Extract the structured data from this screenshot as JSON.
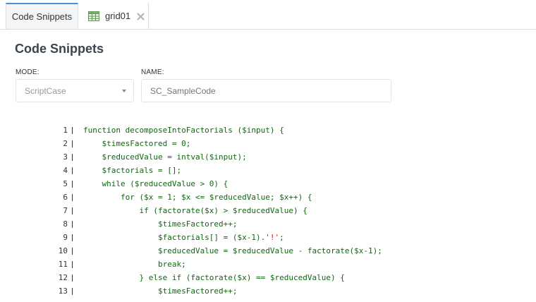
{
  "tabs": [
    {
      "label": "Code Snippets",
      "active": true
    },
    {
      "label": "grid01",
      "icon": "grid-icon",
      "closable": true
    }
  ],
  "page": {
    "title": "Code Snippets"
  },
  "form": {
    "mode": {
      "label": "MODE:",
      "value": "ScriptCase"
    },
    "name": {
      "label": "NAME:",
      "placeholder": "SC_SampleCode"
    }
  },
  "colors": {
    "accent": "#4a90d9",
    "code_text": "#116611",
    "code_string": "#cc2222"
  },
  "code": {
    "lines": [
      {
        "num": "1",
        "pre": "function decomposeIntoFactorials ($input) {",
        "str": "",
        "post": ""
      },
      {
        "num": "2",
        "pre": "    $timesFactored = 0;",
        "str": "",
        "post": ""
      },
      {
        "num": "3",
        "pre": "    $reducedValue = intval($input);",
        "str": "",
        "post": ""
      },
      {
        "num": "4",
        "pre": "    $factorials = [];",
        "str": "",
        "post": ""
      },
      {
        "num": "5",
        "pre": "    while ($reducedValue > 0) {",
        "str": "",
        "post": ""
      },
      {
        "num": "6",
        "pre": "        for ($x = 1; $x <= $reducedValue; $x++) {",
        "str": "",
        "post": ""
      },
      {
        "num": "7",
        "pre": "            if (factorate($x) > $reducedValue) {",
        "str": "",
        "post": ""
      },
      {
        "num": "8",
        "pre": "                $timesFactored++;",
        "str": "",
        "post": ""
      },
      {
        "num": "9",
        "pre": "                $factorials[] = ($x-1).",
        "str": "'!'",
        "post": ";"
      },
      {
        "num": "10",
        "pre": "                $reducedValue = $reducedValue - factorate($x-1);",
        "str": "",
        "post": ""
      },
      {
        "num": "11",
        "pre": "                break;",
        "str": "",
        "post": ""
      },
      {
        "num": "12",
        "pre": "            } else if (factorate($x) == $reducedValue) {",
        "str": "",
        "post": ""
      },
      {
        "num": "13",
        "pre": "                $timesFactored++;",
        "str": "",
        "post": ""
      }
    ]
  }
}
